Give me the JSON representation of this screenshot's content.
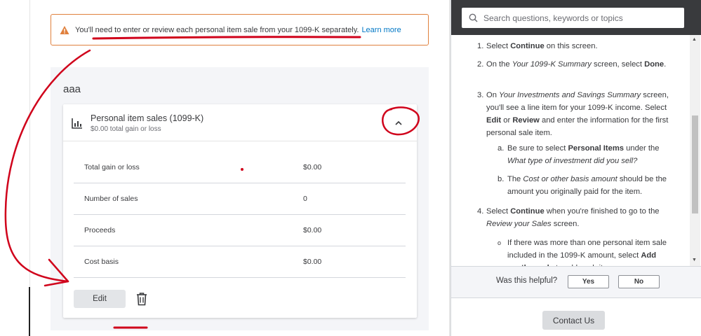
{
  "alert": {
    "text": "You'll need to enter or review each personal item sale from your 1099-K separately.",
    "link": "Learn more",
    "color": "#e0803d"
  },
  "section": {
    "title": "aaa"
  },
  "card": {
    "title": "Personal item sales (1099-K)",
    "subtitle": "$0.00 total gain or loss",
    "rows": [
      {
        "label": "Total gain or loss",
        "value": "$0.00"
      },
      {
        "label": "Number of sales",
        "value": "0"
      },
      {
        "label": "Proceeds",
        "value": "$0.00"
      },
      {
        "label": "Cost basis",
        "value": "$0.00"
      }
    ],
    "edit_label": "Edit"
  },
  "help": {
    "search_placeholder": "Search questions, keywords or topics",
    "step1_num": "1.",
    "step1": "Select Continue on this screen.",
    "step2_num": "2.",
    "step3_num": "3.",
    "step3a_num": "a.",
    "step3b_num": "b.",
    "step4_num": "4.",
    "bullet": "o",
    "feedback_question": "Was this helpful?",
    "yes": "Yes",
    "no": "No",
    "contact": "Contact Us"
  },
  "colors": {
    "accent": "#0077c5",
    "annotation": "#d0021b",
    "header_dark": "#393a3d"
  }
}
